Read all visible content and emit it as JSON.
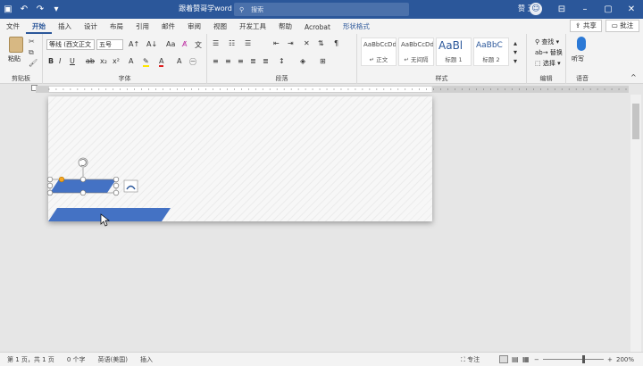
{
  "titlebar": {
    "doc_title": "跟着赞哥学word",
    "search_placeholder": "搜索",
    "user_name": "赞 王",
    "bg_color": "#2b579a"
  },
  "tabs": [
    {
      "label": "文件"
    },
    {
      "label": "开始"
    },
    {
      "label": "插入"
    },
    {
      "label": "设计"
    },
    {
      "label": "布局"
    },
    {
      "label": "引用"
    },
    {
      "label": "邮件"
    },
    {
      "label": "审阅"
    },
    {
      "label": "视图"
    },
    {
      "label": "开发工具"
    },
    {
      "label": "帮助"
    },
    {
      "label": "Acrobat"
    },
    {
      "label": "形状格式"
    }
  ],
  "active_tab": "开始",
  "share_label": "共享",
  "comment_label": "批注",
  "ribbon": {
    "clipboard": {
      "paste": "粘贴",
      "group": "剪贴板"
    },
    "font": {
      "font_name": "等线 (西文正文",
      "font_size": "五号",
      "group": "字体"
    },
    "paragraph": {
      "group": "段落"
    },
    "styles": {
      "group": "样式",
      "items": [
        {
          "sample": "AaBbCcDd",
          "name": "↵ 正文"
        },
        {
          "sample": "AaBbCcDd",
          "name": "↵ 无间隔"
        },
        {
          "sample": "AaBl",
          "name": "标题 1"
        },
        {
          "sample": "AaBbC",
          "name": "标题 2"
        }
      ]
    },
    "editing": {
      "find": "查找",
      "replace": "替换",
      "select": "选择",
      "group": "编辑"
    },
    "voice": {
      "dictate": "听写",
      "group": "语音"
    }
  },
  "shapes": {
    "fill_color": "#4472c4"
  },
  "statusbar": {
    "page": "第 1 页，共 1 页",
    "words": "0 个字",
    "language": "英语(美国)",
    "insert_mode": "插入",
    "focus": "专注",
    "zoom": "200%"
  }
}
